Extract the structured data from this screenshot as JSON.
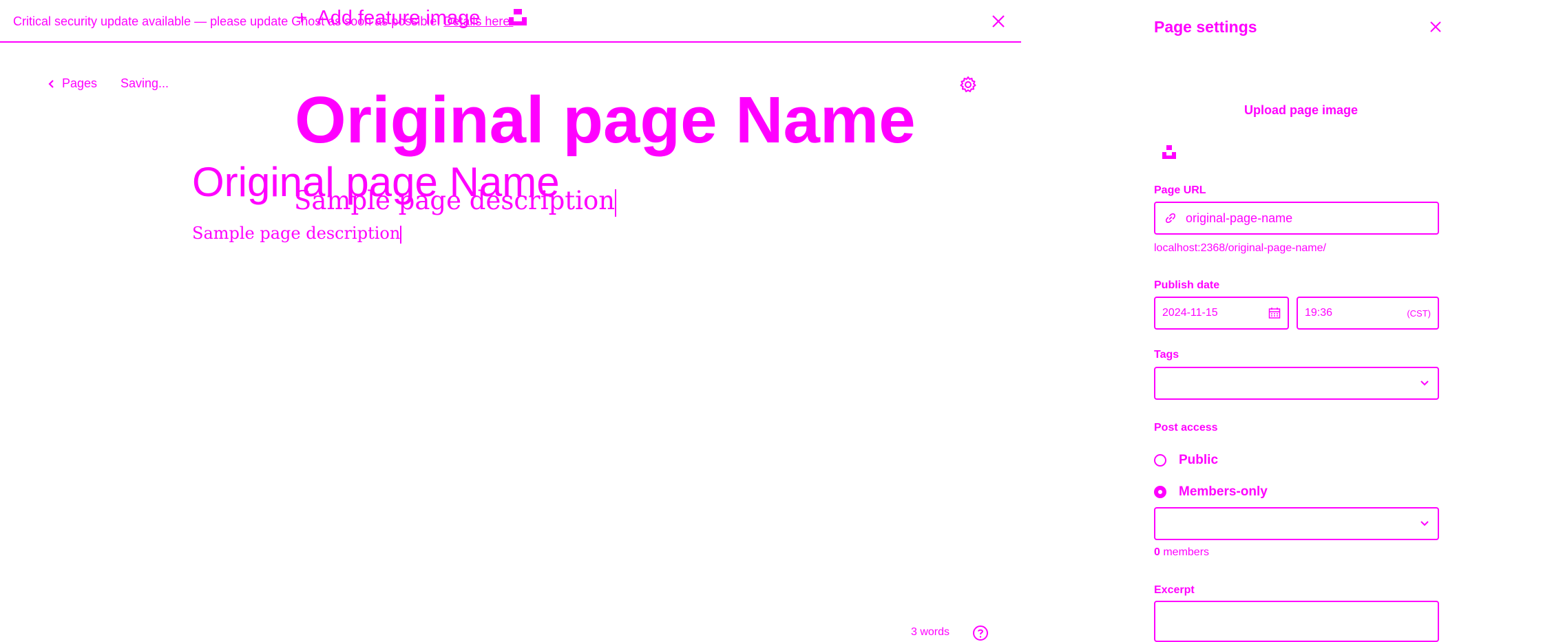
{
  "colors": {
    "accent": "#ff00ff",
    "background": "#ffffff"
  },
  "banner": {
    "text": "Critical security update available — please update Ghost as soon as possible. ",
    "link": "Details here.",
    "close_icon": "close-icon"
  },
  "feature_image": {
    "plus": "+",
    "label": "Add feature image",
    "icon": "unsplash-icon"
  },
  "header": {
    "back_label": "Pages",
    "status": "Saving...",
    "settings_icon": "gear-icon"
  },
  "editor": {
    "title_display": "Original page Name",
    "title_input": "Original page Name",
    "description_display": "Sample page description",
    "description_input": "Sample page description"
  },
  "footer": {
    "word_count": "3 words",
    "help_icon": "help-icon"
  },
  "settings": {
    "title": "Page settings",
    "upload_image": "Upload page image",
    "page_url": {
      "label": "Page URL",
      "value": "original-page-name",
      "preview": "localhost:2368/original-page-name/"
    },
    "publish_date": {
      "label": "Publish date",
      "date": "2024-11-15",
      "time": "19:36",
      "timezone": "(CST)"
    },
    "tags": {
      "label": "Tags",
      "value": ""
    },
    "post_access": {
      "label": "Post access",
      "options": [
        {
          "label": "Public",
          "selected": false
        },
        {
          "label": "Members-only",
          "selected": true
        }
      ],
      "tier_select": "",
      "members_count": "0",
      "members_suffix": " members"
    },
    "excerpt": {
      "label": "Excerpt",
      "value": ""
    }
  }
}
